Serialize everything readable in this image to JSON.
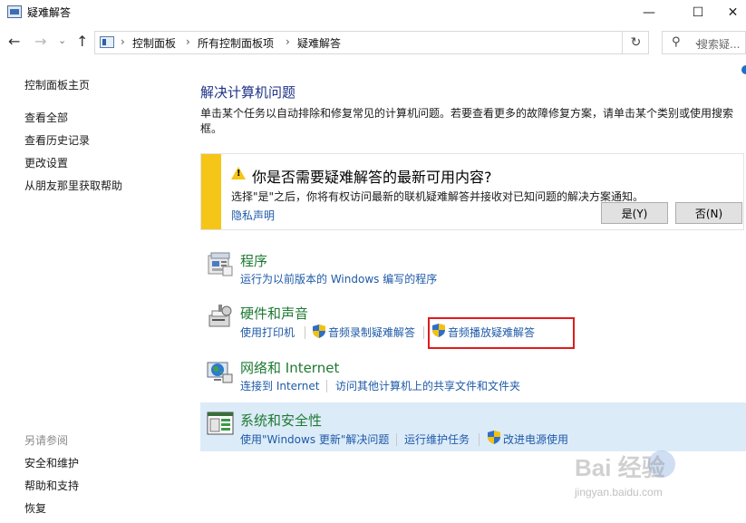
{
  "window": {
    "title": "疑难解答",
    "minimize_glyph": "—",
    "maximize_glyph": "☐",
    "close_glyph": "✕"
  },
  "nav": {
    "back_glyph": "←",
    "forward_glyph": "→",
    "recent_glyph": "⌄",
    "up_glyph": "↑"
  },
  "address": {
    "crumbs": [
      "控制面板",
      "所有控制面板项",
      "疑难解答"
    ],
    "separator": "›",
    "dropdown_glyph": "⌄",
    "refresh_glyph": "↻"
  },
  "search": {
    "placeholder": "搜索疑...",
    "icon": "search-icon",
    "icon_glyph": "⚲"
  },
  "sidebar": {
    "home": "控制面板主页",
    "items": [
      "查看全部",
      "查看历史记录",
      "更改设置",
      "从朋友那里获取帮助"
    ],
    "see_also_label": "另请参阅",
    "see_also": [
      "安全和维护",
      "帮助和支持",
      "恢复"
    ]
  },
  "main": {
    "title": "解决计算机问题",
    "description": "单击某个任务以自动排除和修复常见的计算机问题。若要查看更多的故障修复方案，请单击某个类别或使用搜索框。"
  },
  "notice": {
    "title": "你是否需要疑难解答的最新可用内容?",
    "text": "选择\"是\"之后，你将有权访问最新的联机疑难解答并接收对已知问题的解决方案通知。",
    "privacy_link": "隐私声明",
    "yes_label": "是(Y)",
    "no_label": "否(N)",
    "accent_color": "#f5c518"
  },
  "categories": [
    {
      "title": "程序",
      "icon": "programs-icon",
      "links": [
        "运行为以前版本的 Windows 编写的程序"
      ]
    },
    {
      "title": "硬件和声音",
      "icon": "hardware-sound-icon",
      "links": [
        "使用打印机",
        "音频录制疑难解答",
        "音频播放疑难解答"
      ]
    },
    {
      "title": "网络和 Internet",
      "icon": "network-icon",
      "links": [
        "连接到 Internet",
        "访问其他计算机上的共享文件和文件夹"
      ]
    },
    {
      "title": "系统和安全性",
      "icon": "system-security-icon",
      "links": [
        "使用\"Windows 更新\"解决问题",
        "运行维护任务",
        "改进电源使用"
      ]
    }
  ],
  "colors": {
    "link": "#1e5aa8",
    "category_title": "#1e7a33",
    "heading": "#1e3287",
    "selected_band": "#dcebf8",
    "highlight_box": "#e01b1b"
  },
  "watermark": {
    "brand": "Bai 经验",
    "url": "jingyan.baidu.com"
  }
}
